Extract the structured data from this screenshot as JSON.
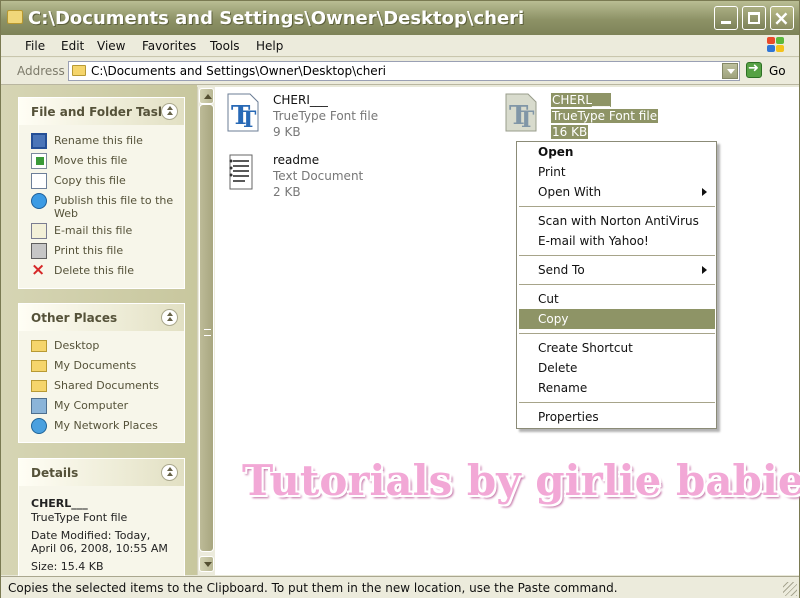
{
  "window": {
    "title": "C:\\Documents and Settings\\Owner\\Desktop\\cheri"
  },
  "menubar": [
    "File",
    "Edit",
    "View",
    "Favorites",
    "Tools",
    "Help"
  ],
  "address": {
    "label": "Address",
    "path": "C:\\Documents and Settings\\Owner\\Desktop\\cheri",
    "go": "Go"
  },
  "panels": {
    "tasks": {
      "title": "File and Folder Tasks",
      "items": [
        "Rename this file",
        "Move this file",
        "Copy this file",
        "Publish this file to the Web",
        "E-mail this file",
        "Print this file",
        "Delete this file"
      ]
    },
    "places": {
      "title": "Other Places",
      "items": [
        "Desktop",
        "My Documents",
        "Shared Documents",
        "My Computer",
        "My Network Places"
      ]
    },
    "details": {
      "title": "Details",
      "name": "CHERL___",
      "type": "TrueType Font file",
      "modified": "Date Modified: Today, April 06, 2008, 10:55 AM",
      "size": "Size: 15.4 KB"
    }
  },
  "files": [
    {
      "name": "CHERI___",
      "type": "TrueType Font file",
      "size": "9 KB"
    },
    {
      "name": "CHERL___",
      "type": "TrueType Font file",
      "size": "16 KB"
    },
    {
      "name": "readme",
      "type": "Text Document",
      "size": "2 KB"
    }
  ],
  "context_menu": [
    "Open",
    "Print",
    "Open With",
    "Scan with Norton AntiVirus",
    "E-mail with Yahoo!",
    "Send To",
    "Cut",
    "Copy",
    "Create Shortcut",
    "Delete",
    "Rename",
    "Properties"
  ],
  "watermark": "Tutorials by girlie babie",
  "status": "Copies the selected items to the Clipboard. To put them in the new location, use the Paste command.",
  "colors": {
    "selection": "#8e9466",
    "titlebar": "#8d9266",
    "watermark": "#f2a8d6"
  }
}
